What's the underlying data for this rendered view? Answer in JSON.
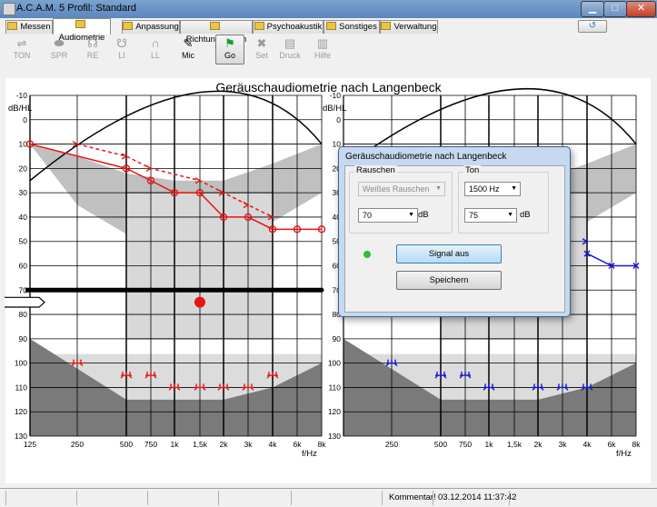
{
  "window": {
    "title": "A.C.A.M. 5  Profil: Standard",
    "min": "▁",
    "max": "□",
    "close": "✕"
  },
  "tabs": [
    {
      "label": "Messen",
      "active": false
    },
    {
      "label": "Audiometrie",
      "active": true
    },
    {
      "label": "Anpassung",
      "active": false
    },
    {
      "label": "Richtungshören",
      "active": false
    },
    {
      "label": "Psychoakustik",
      "active": false
    },
    {
      "label": "Sonstiges",
      "active": false
    },
    {
      "label": "Verwaltung",
      "active": false
    }
  ],
  "help_icon": "↺",
  "toolbar": [
    {
      "label": "TON",
      "icon": "sliders-icon",
      "glyph": "⇌",
      "state": "disabled"
    },
    {
      "label": "SPR",
      "icon": "lips-icon",
      "glyph": "⬬",
      "state": "disabled"
    },
    {
      "label": "RE",
      "icon": "ear-right-icon",
      "glyph": "☊",
      "state": "disabled"
    },
    {
      "label": "LI",
      "icon": "ear-left-icon",
      "glyph": "☋",
      "state": "disabled"
    },
    {
      "label": "LL",
      "icon": "headphones-icon",
      "glyph": "🎧",
      "state": "disabled"
    },
    {
      "label": "Mic",
      "icon": "microphone-icon",
      "glyph": "✎",
      "state": "enabled"
    },
    {
      "label": "Go",
      "icon": "run-icon",
      "glyph": "🏃",
      "state": "selected"
    },
    {
      "label": "Set",
      "icon": "tools-icon",
      "glyph": "✖",
      "state": "disabled"
    },
    {
      "label": "Druck",
      "icon": "printer-icon",
      "glyph": "▤",
      "state": "disabled"
    },
    {
      "label": "Hilfe",
      "icon": "help-book-icon",
      "glyph": "▥",
      "state": "disabled"
    }
  ],
  "chart_title": "Geräuschaudiometrie nach Langenbeck",
  "chart_data": [
    {
      "type": "line",
      "panel": "left",
      "ylabel": "dB/HL",
      "xlabel": "f/Hz",
      "y_ticks": [
        -10,
        0,
        10,
        20,
        30,
        40,
        50,
        60,
        70,
        80,
        90,
        100,
        110,
        120,
        130
      ],
      "x_ticks": [
        "125",
        "250",
        "500",
        "750",
        "1k",
        "1,5k",
        "2k",
        "3k",
        "4k",
        "6k",
        "8k"
      ],
      "ylim": [
        -10,
        130
      ],
      "y_inverted": true,
      "series": [
        {
          "style": "solid",
          "color": "#e81414",
          "marker": "circle",
          "x": [
            "125",
            "500",
            "750",
            "1k",
            "1,5k",
            "2k",
            "3k",
            "4k",
            "6k",
            "8k"
          ],
          "y": [
            10,
            20,
            25,
            30,
            30,
            40,
            40,
            45,
            45,
            45
          ]
        },
        {
          "style": "dashed",
          "color": "#e81414",
          "marker": "arrow",
          "x": [
            "250",
            "500",
            "750",
            "1,5k",
            "2k",
            "3k",
            "4k"
          ],
          "y": [
            10,
            15,
            20,
            25,
            30,
            35,
            40
          ]
        },
        {
          "style": "symbol",
          "color": "#e81414",
          "marker": "bone",
          "x": [
            "250",
            "500",
            "750",
            "1k",
            "1,5k",
            "2k",
            "3k",
            "4k"
          ],
          "y": [
            100,
            105,
            105,
            110,
            110,
            110,
            110,
            105
          ]
        }
      ],
      "noise_level_line": 70,
      "signal_point": {
        "x": "1,5k",
        "y": 75
      }
    },
    {
      "type": "line",
      "panel": "right",
      "ylabel": "dB/HL",
      "xlabel": "f/Hz",
      "y_ticks": [
        -10,
        0,
        10,
        20,
        30,
        40,
        50,
        60,
        70,
        80,
        90,
        100,
        110,
        120,
        130
      ],
      "x_ticks": [
        "250",
        "500",
        "750",
        "1k",
        "1,5k",
        "2k",
        "3k",
        "4k",
        "6k",
        "8k"
      ],
      "ylim": [
        -10,
        130
      ],
      "y_inverted": true,
      "series": [
        {
          "style": "solid",
          "color": "#1414d8",
          "marker": "x",
          "x": [
            "4k",
            "6k",
            "8k"
          ],
          "y": [
            55,
            60,
            60
          ]
        },
        {
          "style": "dashed",
          "color": "#1414d8",
          "marker": "arrow",
          "x": [
            "4k"
          ],
          "y": [
            50
          ]
        },
        {
          "style": "symbol",
          "color": "#1414d8",
          "marker": "bone",
          "x": [
            "250",
            "500",
            "750",
            "1k",
            "2k",
            "3k",
            "4k"
          ],
          "y": [
            100,
            105,
            105,
            110,
            110,
            110,
            110
          ]
        }
      ]
    }
  ],
  "dialog": {
    "title": "Geräuschaudiometrie nach Langenbeck",
    "rauschen_label": "Rauschen",
    "rauschen_type": "Weißes Rauschen",
    "rauschen_level": "70",
    "rauschen_unit": "dB",
    "ton_label": "Ton",
    "ton_freq": "1500 Hz",
    "ton_level": "75",
    "ton_unit": "dB",
    "signal_button": "Signal aus",
    "save_button": "Speichern"
  },
  "status": {
    "comment": "Kommentar!",
    "datetime": "03.12.2014 11:37:42"
  }
}
